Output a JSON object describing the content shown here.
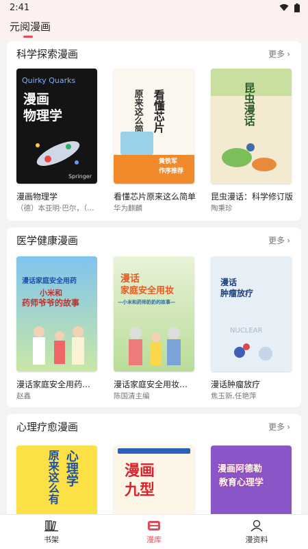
{
  "status": {
    "time": "2:41"
  },
  "header": {
    "title": "元阅漫画"
  },
  "sections": [
    {
      "title": "科学探索漫画",
      "more": "更多",
      "books": [
        {
          "title": "漫画物理学",
          "author": "（德）本亚明·巴尔，（德）",
          "cover_lines": [
            "Quirky Quarks",
            "漫画",
            "物理学",
            "Springer"
          ]
        },
        {
          "title": "看懂芯片原来这么简单",
          "author": "华为麒麟",
          "cover_lines": [
            "看懂芯片",
            "原来这么简单",
            "作序推荐",
            "黄铁军"
          ]
        },
        {
          "title": "昆虫漫话：科学修订版",
          "author": "陶秉珍",
          "cover_lines": [
            "昆虫漫话"
          ]
        }
      ]
    },
    {
      "title": "医学健康漫画",
      "more": "更多",
      "books": [
        {
          "title": "漫话家庭安全用药：小米和药师爷爷的故事",
          "author": "赵鑫",
          "cover_lines": [
            "漫话家庭安全用药",
            "小米和",
            "药师爷爷的故事"
          ]
        },
        {
          "title": "漫话家庭安全用妆——小米和药师奶奶的故事",
          "author": "陈国清主编",
          "cover_lines": [
            "漫话",
            "家庭安全用妆",
            "—小米和药师奶奶的故事—"
          ]
        },
        {
          "title": "漫话肿瘤放疗",
          "author": "焦玉新,任艳萍",
          "cover_lines": [
            "漫话",
            "肿瘤放疗",
            "NUCLEAR"
          ]
        }
      ]
    },
    {
      "title": "心理疗愈漫画",
      "more": "更多",
      "books": [
        {
          "title": "原来这么有趣心理学",
          "author": "",
          "cover_lines": [
            "原来这么有",
            "心理学"
          ]
        },
        {
          "title": "漫画九型人格",
          "author": "",
          "cover_lines": [
            "漫画",
            "九型"
          ]
        },
        {
          "title": "漫画阿德勒教育心理学",
          "author": "",
          "cover_lines": [
            "漫画阿德勒",
            "教育心理学"
          ]
        }
      ]
    }
  ],
  "bottom_nav": [
    {
      "label": "书架",
      "icon": "bookshelf-icon",
      "active": false
    },
    {
      "label": "漫库",
      "icon": "comic-library-icon",
      "active": true
    },
    {
      "label": "漫资料",
      "icon": "profile-icon",
      "active": false
    }
  ],
  "colors": {
    "accent": "#e64b55"
  }
}
